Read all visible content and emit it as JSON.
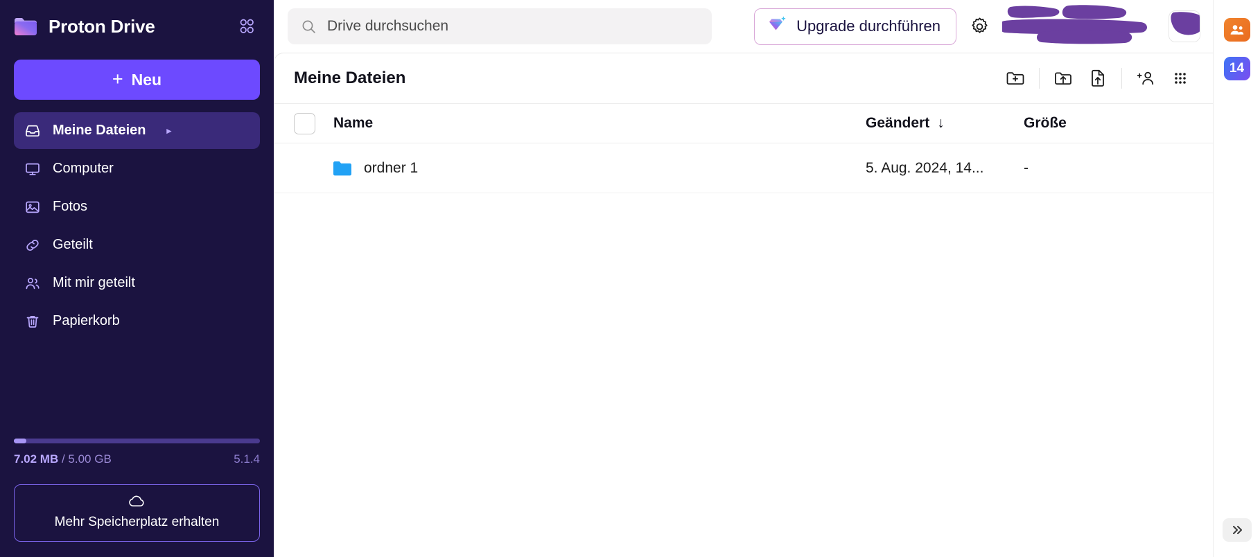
{
  "brand": {
    "name": "Proton Drive",
    "logo_icon": "proton-drive-folder-logo",
    "apps_icon": "apps-grid-icon"
  },
  "sidebar": {
    "new_button": {
      "label": "Neu",
      "icon": "plus-icon"
    },
    "items": [
      {
        "label": "Meine Dateien",
        "icon": "inbox-icon",
        "active": true,
        "has_caret": true,
        "caret": "▸"
      },
      {
        "label": "Computer",
        "icon": "monitor-icon",
        "active": false,
        "has_caret": false,
        "caret": ""
      },
      {
        "label": "Fotos",
        "icon": "image-icon",
        "active": false,
        "has_caret": false,
        "caret": ""
      },
      {
        "label": "Geteilt",
        "icon": "link-icon",
        "active": false,
        "has_caret": false,
        "caret": ""
      },
      {
        "label": "Mit mir geteilt",
        "icon": "users-icon",
        "active": false,
        "has_caret": false,
        "caret": ""
      },
      {
        "label": "Papierkorb",
        "icon": "trash-icon",
        "active": false,
        "has_caret": false,
        "caret": ""
      }
    ],
    "storage": {
      "used": "7.02 MB",
      "separator_and_total": " / 5.00 GB",
      "percent": 0.14,
      "version": "5.1.4"
    },
    "more_storage": {
      "label": "Mehr Speicherplatz erhalten",
      "icon": "cloud-icon"
    }
  },
  "topbar": {
    "search": {
      "placeholder": "Drive durchsuchen",
      "value": "",
      "icon": "search-icon"
    },
    "upgrade": {
      "label": "Upgrade durchführen",
      "icon": "diamond-plus-icon"
    },
    "settings": {
      "icon": "gear-icon"
    },
    "redaction": {
      "icon": "purple-scribble-redaction",
      "color": "#6b3fa0"
    },
    "avatar": {
      "icon": "user-avatar"
    }
  },
  "content": {
    "title": "Meine Dateien",
    "toolbar": [
      {
        "name": "new-folder-button",
        "icon": "folder-plus-icon"
      },
      {
        "name": "upload-folder-button",
        "icon": "folder-upload-icon"
      },
      {
        "name": "upload-file-button",
        "icon": "file-upload-icon"
      },
      {
        "name": "share-button",
        "icon": "user-plus-icon"
      },
      {
        "name": "layout-button",
        "icon": "grid-dots-icon"
      }
    ],
    "columns": {
      "name": "Name",
      "modified": "Geändert",
      "modified_sort": "↓",
      "size": "Größe"
    },
    "rows": [
      {
        "name": "ordner 1",
        "icon": "folder-icon",
        "icon_color": "#22a2f5",
        "modified": "5. Aug. 2024, 14...",
        "size": "-"
      }
    ]
  },
  "rail": {
    "apps": [
      {
        "name": "contacts",
        "label": "",
        "icon": "contacts-icon"
      },
      {
        "name": "calendar",
        "label": "14",
        "icon": "calendar-icon"
      }
    ],
    "expand": {
      "label": "»",
      "icon": "chevron-double-right-icon"
    }
  }
}
